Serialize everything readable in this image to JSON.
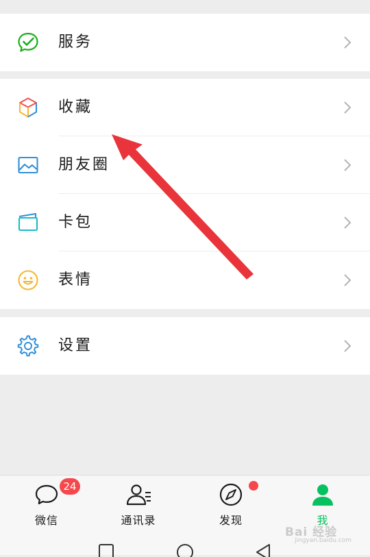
{
  "colors": {
    "accent_green": "#07c160",
    "badge_red": "#f5484c",
    "arrow_red": "#e8343a"
  },
  "menu": {
    "services": {
      "label": "服务",
      "icon": "wechat-pay-icon"
    },
    "favorites": {
      "label": "收藏",
      "icon": "favorites-cube-icon"
    },
    "moments": {
      "label": "朋友圈",
      "icon": "moments-photo-icon"
    },
    "cards": {
      "label": "卡包",
      "icon": "card-wallet-icon"
    },
    "stickers": {
      "label": "表情",
      "icon": "smiley-icon"
    },
    "settings": {
      "label": "设置",
      "icon": "gear-icon"
    }
  },
  "tabbar": {
    "chats": {
      "label": "微信",
      "badge": "24",
      "icon": "chat-bubble-icon"
    },
    "contacts": {
      "label": "通讯录",
      "icon": "contacts-icon"
    },
    "discover": {
      "label": "发现",
      "icon": "compass-icon"
    },
    "me": {
      "label": "我",
      "icon": "person-icon"
    }
  },
  "watermark": {
    "text": "Bai 经验",
    "sub": "jingyan.baidu.com"
  }
}
